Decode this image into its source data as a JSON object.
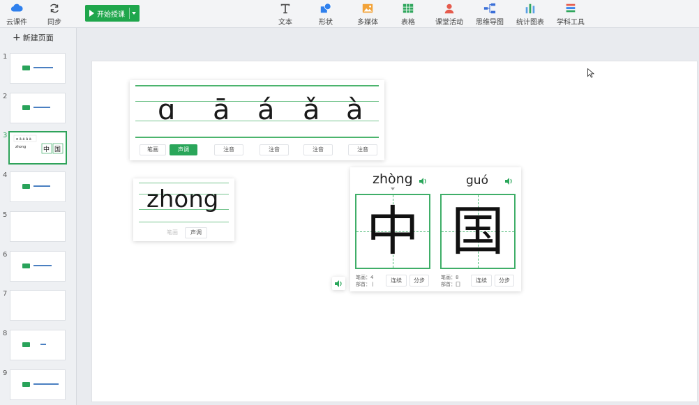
{
  "toolbar": {
    "cloud_label": "云课件",
    "sync_label": "同步",
    "start_label": "开始授课",
    "tools": [
      {
        "label": "文本",
        "icon": "text-icon"
      },
      {
        "label": "形状",
        "icon": "shape-icon"
      },
      {
        "label": "多媒体",
        "icon": "media-icon"
      },
      {
        "label": "表格",
        "icon": "table-icon"
      },
      {
        "label": "课堂活动",
        "icon": "activity-icon"
      },
      {
        "label": "思维导图",
        "icon": "mindmap-icon"
      },
      {
        "label": "统计图表",
        "icon": "chart-icon"
      },
      {
        "label": "学科工具",
        "icon": "subject-tools-icon"
      }
    ],
    "colors": {
      "accent_green": "#1fa64c"
    }
  },
  "sidebar": {
    "new_page_label": "新建页面",
    "slides": [
      {
        "num": "1"
      },
      {
        "num": "2"
      },
      {
        "num": "3"
      },
      {
        "num": "4"
      },
      {
        "num": "5"
      },
      {
        "num": "6"
      },
      {
        "num": "7"
      },
      {
        "num": "8"
      },
      {
        "num": "9"
      }
    ],
    "active_slide": "3"
  },
  "pinyin_card": {
    "letters": [
      "ɑ",
      "ā",
      "á",
      "ǎ",
      "à"
    ],
    "buttons": [
      "笔画",
      "声调",
      "注音",
      "注音",
      "注音",
      "注音"
    ]
  },
  "zhong_card": {
    "word": "zhong",
    "buttons": [
      "笔画",
      "声调"
    ]
  },
  "hanzi_card": {
    "chars": [
      {
        "pinyin": "zhòng",
        "char": "中",
        "strokes_label": "笔画：",
        "strokes": "4",
        "radical_label": "部首：",
        "radical": "丨",
        "btn_continuous": "连续",
        "btn_step": "分步"
      },
      {
        "pinyin": "guó",
        "char": "国",
        "strokes_label": "笔画：",
        "strokes": "8",
        "radical_label": "部首：",
        "radical": "囗",
        "btn_continuous": "连续",
        "btn_step": "分步"
      }
    ]
  }
}
